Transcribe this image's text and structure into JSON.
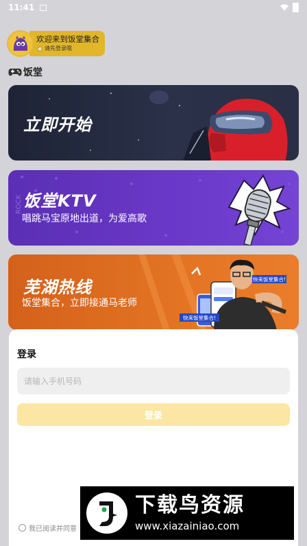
{
  "status_bar": {
    "time": "11:41"
  },
  "header": {
    "welcome": "欢迎来到饭堂集合",
    "login_hint": "请先登录哦"
  },
  "section": {
    "title": "饭堂"
  },
  "banners": [
    {
      "title": "立即开始",
      "subtitle": ""
    },
    {
      "title": "饭堂KTV",
      "subtitle": "唱跳马宝原地出道，为爱高歌"
    },
    {
      "title": "芜湖热线",
      "subtitle": "饭堂集合，立即接通马老师",
      "art_tag_1": "快来饭堂集合!",
      "art_tag_2": "快来饭堂集合!"
    }
  ],
  "login": {
    "title": "登录",
    "phone_placeholder": "请输入手机号码",
    "button_label": "登录",
    "agreement": "我已阅读并同意"
  },
  "watermark": {
    "title": "下载鸟资源",
    "url": "www.xiazainiao.com"
  },
  "colors": {
    "accent": "#e2b629",
    "login_button": "#fbe6a4",
    "background": "#d4d3d8"
  }
}
